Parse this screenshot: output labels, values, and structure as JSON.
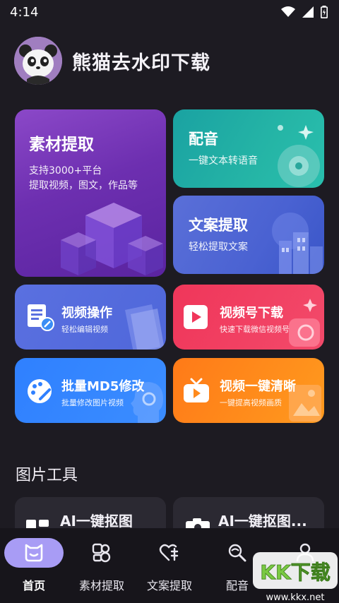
{
  "status": {
    "time": "4:14"
  },
  "app": {
    "title": "熊猫去水印下载"
  },
  "cards": {
    "material": {
      "title": "素材提取",
      "line1": "支持3000+平台",
      "line2": "提取视频，图文，作品等"
    },
    "dub": {
      "title": "配音",
      "subtitle": "一键文本转语音"
    },
    "copy": {
      "title": "文案提取",
      "subtitle": "轻松提取文案"
    },
    "video_op": {
      "title": "视频操作",
      "subtitle": "轻松编辑视频"
    },
    "channel": {
      "title": "视频号下载",
      "subtitle": "快速下载微信视频号"
    },
    "md5": {
      "title": "批量MD5修改",
      "subtitle": "批量修改图片视频"
    },
    "hd": {
      "title": "视频一键清晰",
      "subtitle": "一键提高视频画质"
    }
  },
  "image_tools": {
    "section_title": "图片工具",
    "items": [
      {
        "label": "AI一键抠图"
      },
      {
        "label": "AI一键抠图..."
      }
    ]
  },
  "nav": {
    "items": [
      {
        "label": "首页",
        "icon": "home-face-icon",
        "active": true
      },
      {
        "label": "素材提取",
        "icon": "material-icon"
      },
      {
        "label": "文案提取",
        "icon": "copy-icon"
      },
      {
        "label": "配音",
        "icon": "dub-icon"
      },
      {
        "label": "",
        "icon": "profile-icon"
      }
    ]
  },
  "watermark": {
    "text": "KK下载",
    "url": "www.kkx.net"
  },
  "colors": {
    "background": "#1d1b22",
    "nav_active": "#a89cf5",
    "material": "#7a3cc0",
    "dub": "#22b0a5",
    "copy": "#4f66d4",
    "video_op": "#5469dc",
    "channel": "#f03d60",
    "md5": "#3388ff",
    "hd": "#ff8a1c"
  }
}
